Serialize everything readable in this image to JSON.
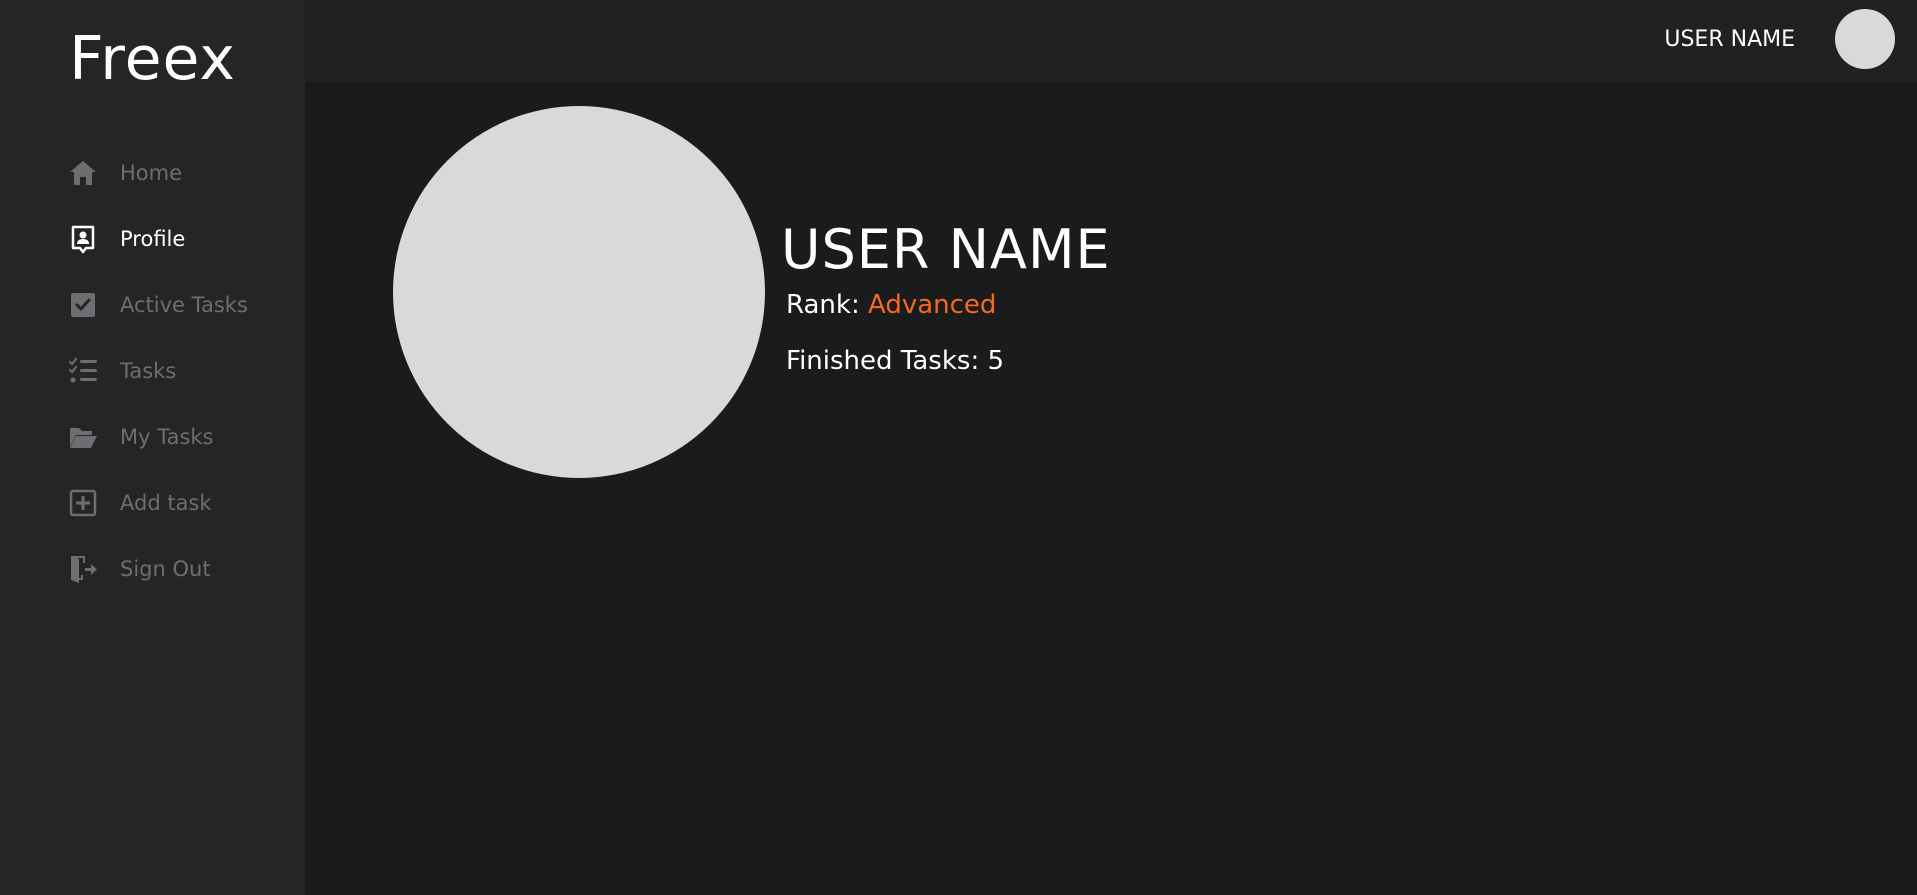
{
  "app": {
    "logo": "Freex"
  },
  "sidebar": {
    "items": [
      {
        "label": "Home",
        "icon": "home-icon",
        "active": false
      },
      {
        "label": "Profile",
        "icon": "profile-icon",
        "active": true
      },
      {
        "label": "Active Tasks",
        "icon": "checkbox-icon",
        "active": false
      },
      {
        "label": "Tasks",
        "icon": "task-list-icon",
        "active": false
      },
      {
        "label": "My Tasks",
        "icon": "folder-open-icon",
        "active": false
      },
      {
        "label": "Add task",
        "icon": "plus-square-icon",
        "active": false
      },
      {
        "label": "Sign Out",
        "icon": "sign-out-icon",
        "active": false
      }
    ]
  },
  "header": {
    "username": "USER NAME"
  },
  "profile": {
    "name": "USER NAME",
    "rank_label": "Rank: ",
    "rank_value": "Advanced",
    "finished_label": "Finished Tasks: ",
    "finished_count": "5"
  },
  "colors": {
    "sidebar_bg": "#252525",
    "main_bg": "#1a1b1d",
    "topbar_bg": "#202123",
    "accent": "#f26a1b",
    "inactive_text": "#6d6e72",
    "avatar": "#d9d9d9"
  }
}
